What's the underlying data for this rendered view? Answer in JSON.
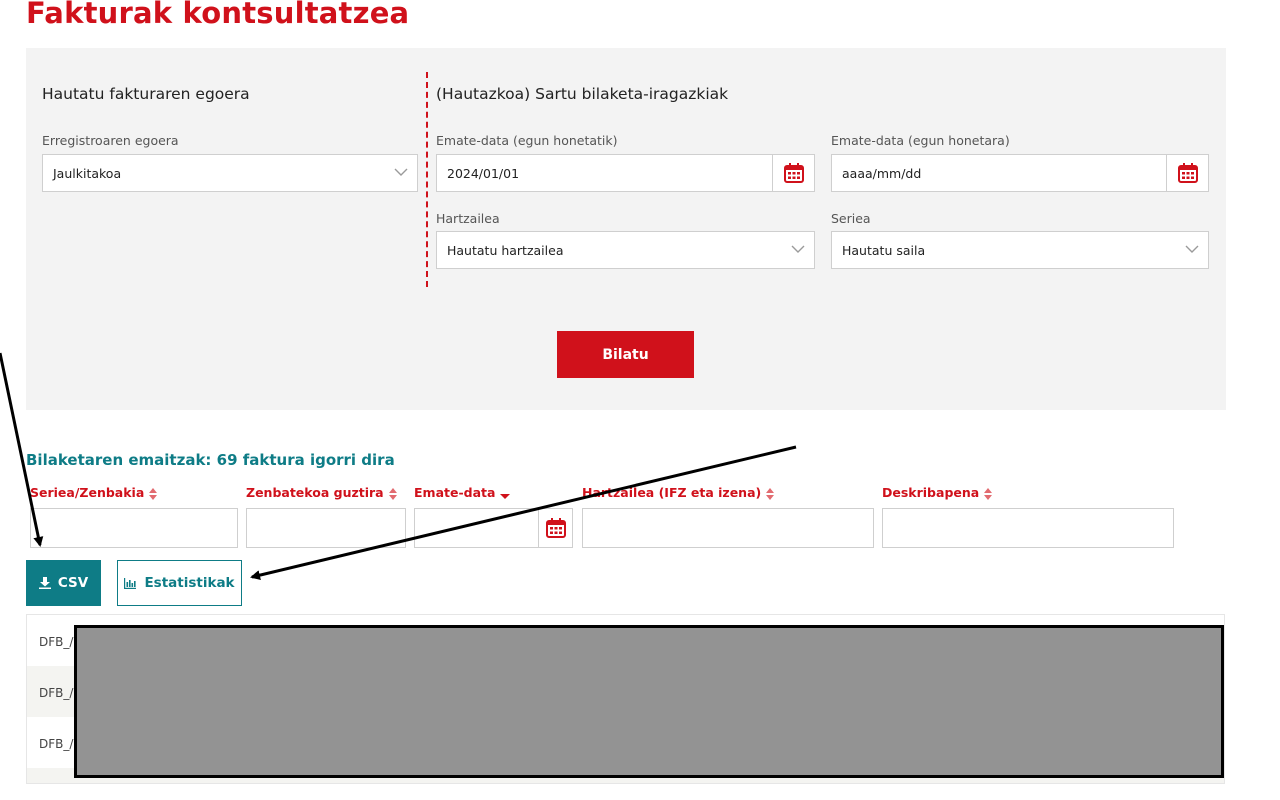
{
  "page": {
    "title": "Fakturak kontsultatzea"
  },
  "status_section": {
    "heading": "Hautatu fakturaren egoera",
    "label": "Erregistroaren egoera",
    "value": "Jaulkitakoa"
  },
  "filters_section": {
    "heading": "(Hautazkoa) Sartu bilaketa-iragazkiak",
    "date_from": {
      "label": "Emate-data (egun honetatik)",
      "value": "2024/01/01"
    },
    "date_to": {
      "label": "Emate-data (egun honetara)",
      "placeholder": "aaaa/mm/dd"
    },
    "recipient": {
      "label": "Hartzailea",
      "value": "Hautatu hartzailea"
    },
    "series": {
      "label": "Seriea",
      "value": "Hautatu saila"
    }
  },
  "search_button": "Bilatu",
  "results": {
    "heading": "Bilaketaren emaitzak: 69 faktura igorri dira",
    "columns": [
      "Seriea/Zenbakia",
      "Zenbatekoa guztira",
      "Emate-data",
      "Hartzailea (IFZ eta izena)",
      "Deskribapena"
    ],
    "csv_label": "CSV",
    "stats_label": "Estatistikak",
    "rows": [
      "DFB_/",
      "DFB_/",
      "DFB_/"
    ]
  },
  "colors": {
    "brand_red": "#d0111b",
    "teal": "#0e7c86",
    "panel": "#f3f3f3",
    "redaction": "#939393"
  },
  "icons": [
    "chevron-down-icon",
    "calendar-icon",
    "sort-icon",
    "sort-desc-icon",
    "download-icon",
    "bar-chart-icon"
  ]
}
